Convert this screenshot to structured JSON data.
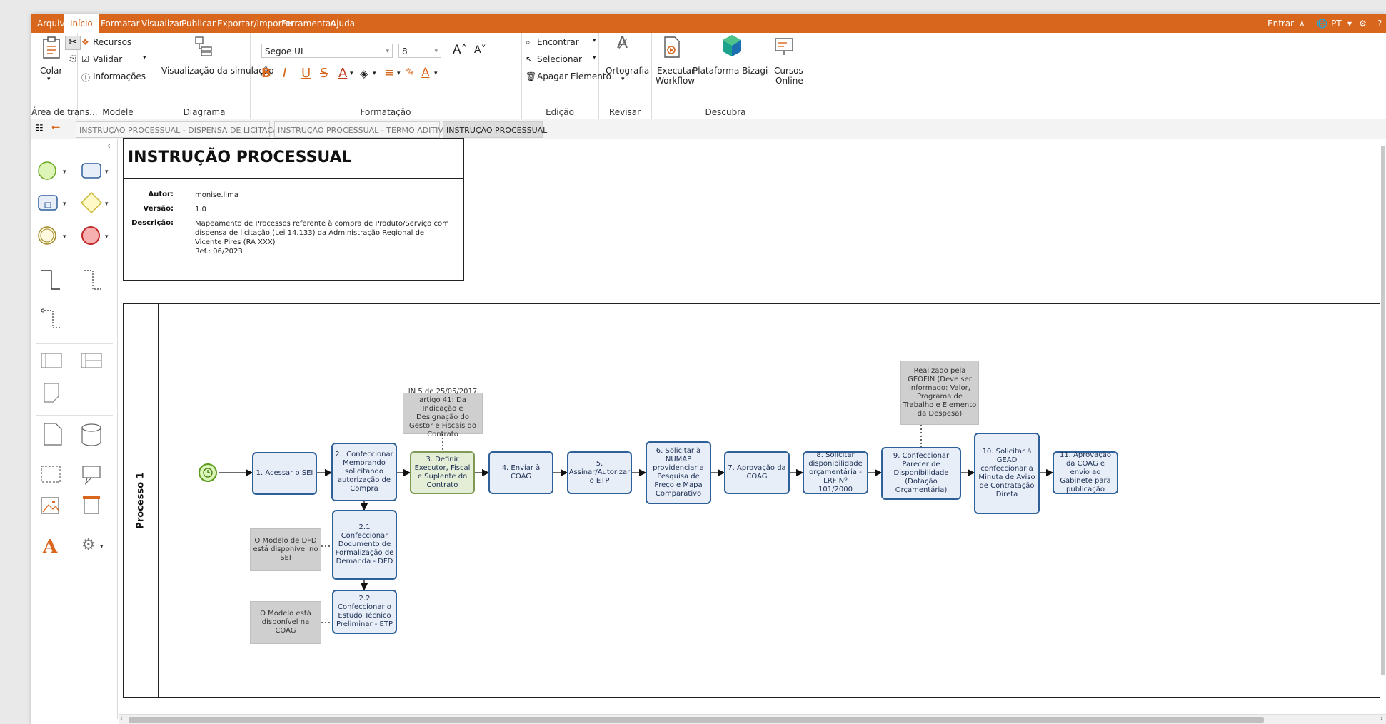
{
  "menu": {
    "items": [
      "Arquivo",
      "Início",
      "Formatar",
      "Visualizar",
      "Publicar",
      "Exportar/importar",
      "Ferramentas",
      "Ajuda"
    ],
    "active": "Início",
    "login": "Entrar",
    "lang": "PT"
  },
  "ribbon": {
    "clipboard": {
      "paste": "Colar",
      "label": "Área de trans..."
    },
    "model": {
      "resources": "Recursos",
      "validate": "Validar",
      "info": "Informações",
      "label": "Modele"
    },
    "diagram": {
      "sim": "Visualização da simulação",
      "label": "Diagrama"
    },
    "format": {
      "font": "Segoe UI",
      "size": "8",
      "label": "Formatação",
      "bold": "B",
      "italic": "I",
      "underline": "U",
      "strike": "S"
    },
    "edit": {
      "find": "Encontrar",
      "select": "Selecionar",
      "delete": "Apagar Elemento",
      "label": "Edição"
    },
    "review": {
      "spell": "Ortografia",
      "label": "Revisar"
    },
    "discover": {
      "workflow1": "Executar",
      "workflow2": "Workflow",
      "platform": "Plataforma Bizagi",
      "courses1": "Cursos",
      "courses2": "Online",
      "label": "Descubra"
    }
  },
  "tabs": [
    "INSTRUÇÃO PROCESSUAL - DISPENSA DE LICITAÇÃO",
    "INSTRUÇÃO PROCESSUAL - TERMO ADITIVO",
    "INSTRUÇÃO PROCESSUAL"
  ],
  "info": {
    "title": "INSTRUÇÃO PROCESSUAL",
    "author_label": "Autor:",
    "author": "monise.lima",
    "version_label": "Versão:",
    "version": "1.0",
    "desc_label": "Descrição:",
    "desc": "Mapeamento de Processos referente à compra de Produto/Serviço com dispensa de licitação (Lei 14.133) da Administração Regional de Vicente Pires (RA XXX)",
    "ref": "Ref.: 06/2023"
  },
  "pool": {
    "label": "Processo 1"
  },
  "tasks": {
    "t1": "1. Acessar o SEI",
    "t2": "2.. Confeccionar Memorando solicitando autorização de Compra",
    "t21": "2.1 Confeccionar Documento de Formalização de Demanda - DFD",
    "t22": "2.2 Confeccionar o Estudo Técnico Preliminar - ETP",
    "t3": "3. Definir Executor, Fiscal e Suplente do Contrato",
    "t4": "4. Enviar à COAG",
    "t5": "5. Assinar/Autorizar o ETP",
    "t6": "6. Solicitar à NUMAP providenciar a Pesquisa de Preço e Mapa Comparativo",
    "t7": "7. Aprovação da COAG",
    "t8": "8. Solicitar disponibilidade orçamentária - LRF Nº 101/2000",
    "t9": "9. Confeccionar Parecer de Disponibilidade (Dotação Orçamentária)",
    "t10": "10. Solicitar à GEAD confeccionar a Minuta de Aviso de Contratação Direta",
    "t11": "11. Aprovação da COAG e envio ao Gabinete para publicação"
  },
  "notes": {
    "n3": "IN 5 de 25/05/2017 artigo 41: Da Indicação e Designação do Gestor e Fiscais do Contrato",
    "n9": "Realizado pela GEOFIN (Deve ser informado: Valor, Programa de Trabalho e Elemento da Despesa)",
    "n21": "O Modelo de DFD está disponível no SEI",
    "n22": "O Modelo está disponível na COAG"
  },
  "colors": {
    "accent": "#d8661c",
    "task_border": "#2d5f98",
    "task_fill": "#e8eef8"
  }
}
